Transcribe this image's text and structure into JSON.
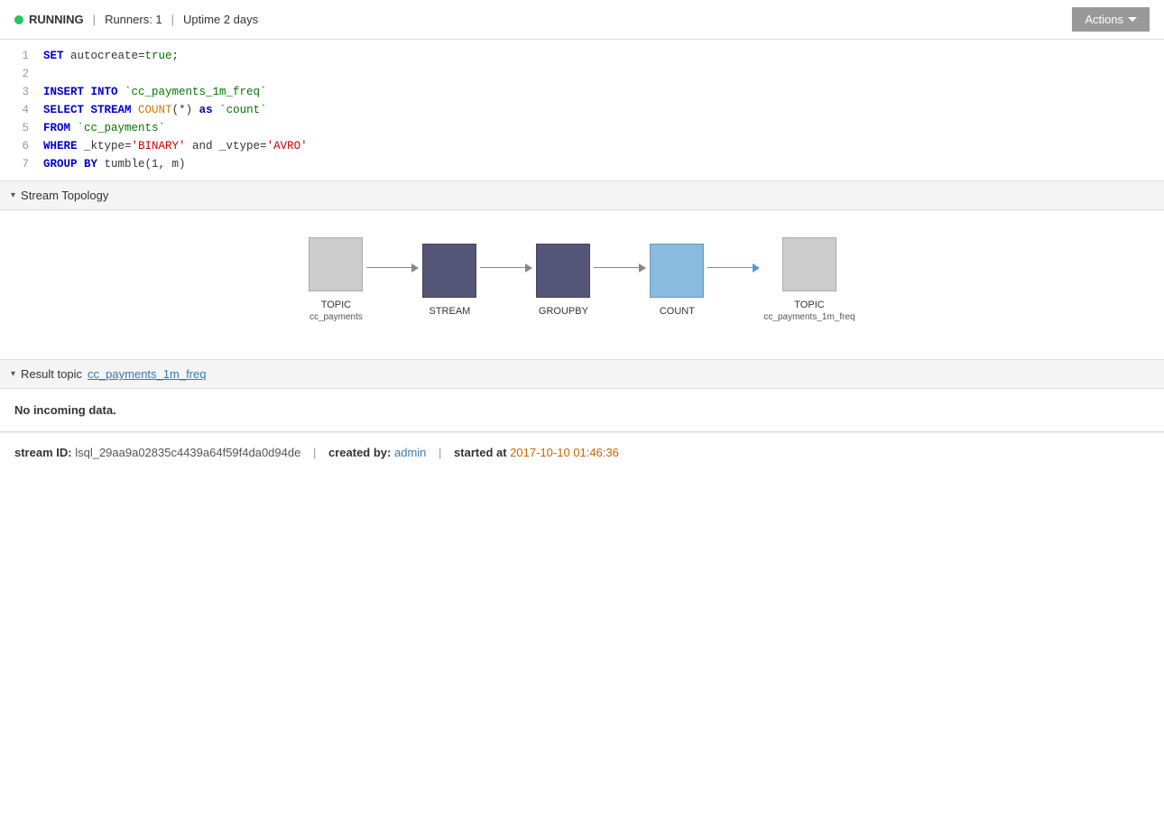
{
  "header": {
    "status_dot_color": "#22c55e",
    "status_label": "RUNNING",
    "sep1": "|",
    "runners_label": "Runners: 1",
    "sep2": "|",
    "uptime_label": "Uptime 2 days",
    "actions_label": "Actions"
  },
  "code": {
    "lines": [
      {
        "num": "1",
        "html_key": "line1"
      },
      {
        "num": "2",
        "html_key": "line2"
      },
      {
        "num": "3",
        "html_key": "line3"
      },
      {
        "num": "4",
        "html_key": "line4"
      },
      {
        "num": "5",
        "html_key": "line5"
      },
      {
        "num": "6",
        "html_key": "line6"
      },
      {
        "num": "7",
        "html_key": "line7"
      }
    ]
  },
  "topology": {
    "section_label": "Stream Topology",
    "nodes": [
      {
        "id": "node-topic-source",
        "type": "gray",
        "label": "TOPIC",
        "sublabel": "cc_payments"
      },
      {
        "id": "node-stream",
        "type": "dark-purple",
        "label": "STREAM",
        "sublabel": ""
      },
      {
        "id": "node-groupby",
        "type": "dark-purple",
        "label": "GROUPBY",
        "sublabel": ""
      },
      {
        "id": "node-count",
        "type": "blue-light",
        "label": "COUNT",
        "sublabel": ""
      },
      {
        "id": "node-topic-dest",
        "type": "gray",
        "label": "TOPIC",
        "sublabel": "cc_payments_1m_freq"
      }
    ],
    "arrows": [
      {
        "id": "arrow1",
        "blue": false
      },
      {
        "id": "arrow2",
        "blue": false
      },
      {
        "id": "arrow3",
        "blue": false
      },
      {
        "id": "arrow4",
        "blue": true
      }
    ]
  },
  "result_topic": {
    "section_label": "Result topic",
    "link_label": "cc_payments_1m_freq",
    "no_data_label": "No incoming data."
  },
  "footer": {
    "stream_id_key": "stream ID:",
    "stream_id_val": "lsql_29aa9a02835c4439a64f59f4da0d94de",
    "created_by_key": "created by:",
    "created_by_val": "admin",
    "started_at_key": "started at",
    "started_at_val": "2017-10-10 01:46:36"
  }
}
